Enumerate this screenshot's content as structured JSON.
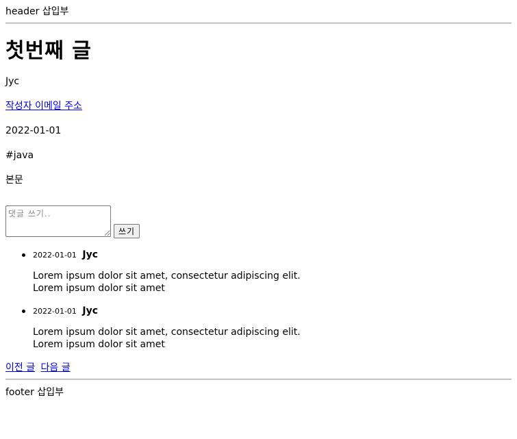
{
  "header": {
    "text": "header 삽입부"
  },
  "article": {
    "title": "첫번째 글",
    "author": "Jyc",
    "email_link": "작성자 이메일 주소",
    "date": "2022-01-01",
    "hashtag": "#java",
    "body": "본문"
  },
  "comment_form": {
    "placeholder": "댓글 쓰기..",
    "submit_label": "쓰기"
  },
  "comments": [
    {
      "date": "2022-01-01",
      "author": "Jyc",
      "text": "Lorem ipsum dolor sit amet, consectetur adipiscing elit.\nLorem ipsum dolor sit amet"
    },
    {
      "date": "2022-01-01",
      "author": "Jyc",
      "text": "Lorem ipsum dolor sit amet, consectetur adipiscing elit.\nLorem ipsum dolor sit amet"
    }
  ],
  "navigation": {
    "prev_label": "이전 글",
    "next_label": "다음 글"
  },
  "footer": {
    "text": "footer 삽입부"
  }
}
